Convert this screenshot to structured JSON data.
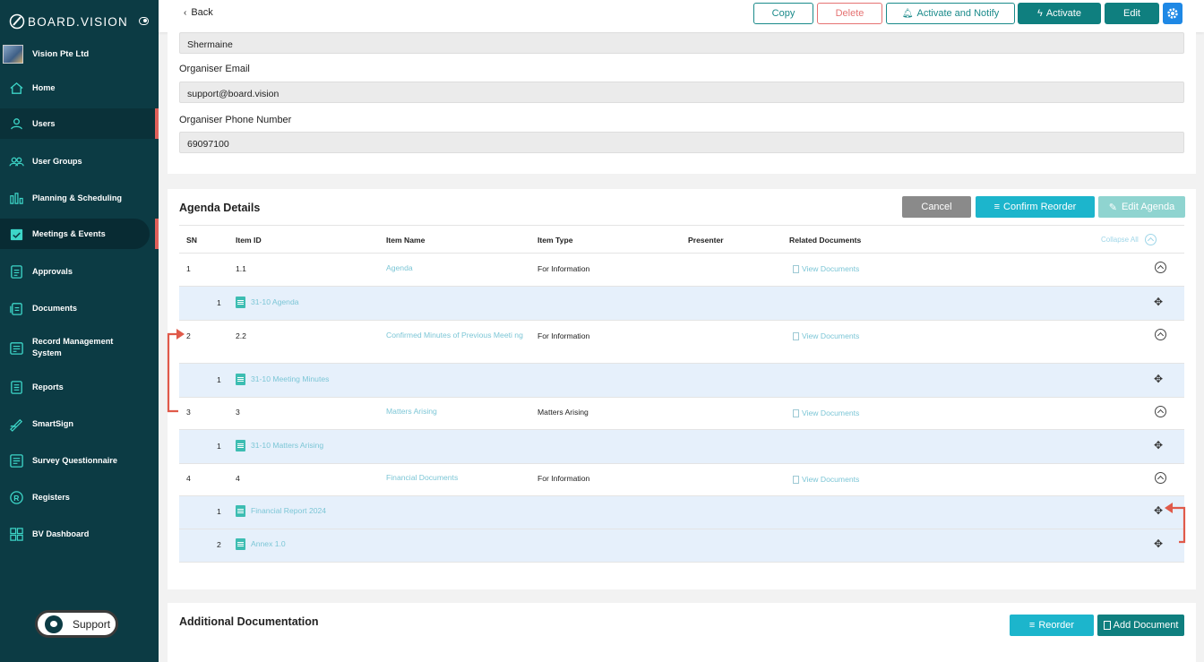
{
  "sidebar": {
    "logo": "BOARD.VISION",
    "org_name": "Vision Pte Ltd",
    "items": [
      {
        "label": "Home"
      },
      {
        "label": "Users"
      },
      {
        "label": "User Groups"
      },
      {
        "label": "Planning & Scheduling"
      },
      {
        "label": "Meetings & Events"
      },
      {
        "label": "Approvals"
      },
      {
        "label": "Documents"
      },
      {
        "label": "Record Management System"
      },
      {
        "label": "Reports"
      },
      {
        "label": "SmartSign"
      },
      {
        "label": "Survey Questionnaire"
      },
      {
        "label": "Registers"
      },
      {
        "label": "BV Dashboard"
      }
    ],
    "support_label": "Support"
  },
  "topbar": {
    "back_label": "Back",
    "copy_label": "Copy",
    "delete_label": "Delete",
    "notify_label": "Activate and Notify",
    "activate_label": "Activate",
    "edit_label": "Edit"
  },
  "organiser": {
    "name_value": "Shermaine",
    "email_label": "Organiser Email",
    "email_value": "support@board.vision",
    "phone_label": "Organiser Phone Number",
    "phone_value": "69097100"
  },
  "agenda": {
    "title": "Agenda Details",
    "cancel_label": "Cancel",
    "confirm_label": "Confirm Reorder",
    "edit_label": "Edit Agenda",
    "collapse_all": "Collapse All",
    "headers": {
      "sn": "SN",
      "item_id": "Item ID",
      "item_name": "Item Name",
      "item_type": "Item Type",
      "presenter": "Presenter",
      "related": "Related Documents"
    },
    "view_docs": "View Documents",
    "rows": [
      {
        "sn": "1",
        "id": "1.1",
        "name": "Agenda",
        "type": "For Information",
        "docs": [
          {
            "sn": "1",
            "name": "31-10 Agenda"
          }
        ]
      },
      {
        "sn": "2",
        "id": "2.2",
        "name": "Confirmed Minutes of Previous Meeti ng",
        "type": "For Information",
        "docs": [
          {
            "sn": "1",
            "name": "31-10 Meeting Minutes"
          }
        ]
      },
      {
        "sn": "3",
        "id": "3",
        "name": "Matters Arising",
        "type": "Matters Arising",
        "docs": [
          {
            "sn": "1",
            "name": "31-10 Matters Arising"
          }
        ]
      },
      {
        "sn": "4",
        "id": "4",
        "name": "Financial Documents",
        "type": "For Information",
        "docs": [
          {
            "sn": "1",
            "name": "Financial Report 2024"
          },
          {
            "sn": "2",
            "name": "Annex 1.0"
          }
        ]
      }
    ]
  },
  "additional": {
    "title": "Additional Documentation",
    "reorder_label": "Reorder",
    "add_label": "Add Document"
  },
  "colors": {
    "sidebar": "#0c3b44",
    "teal": "#0f7f7f",
    "cyan": "#1cb5cc",
    "arrow": "#e05a4a"
  }
}
